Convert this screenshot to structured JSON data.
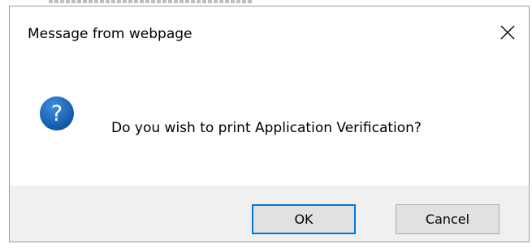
{
  "dialog": {
    "title": "Message from webpage",
    "message": "Do you wish to print Application Verification?",
    "icon": "question-icon",
    "buttons": {
      "ok_label": "OK",
      "cancel_label": "Cancel",
      "default": "OK"
    },
    "colors": {
      "icon_blue": "#1565c0",
      "default_button_border": "#0078d7",
      "footer_bg": "#f0f0f0"
    }
  }
}
